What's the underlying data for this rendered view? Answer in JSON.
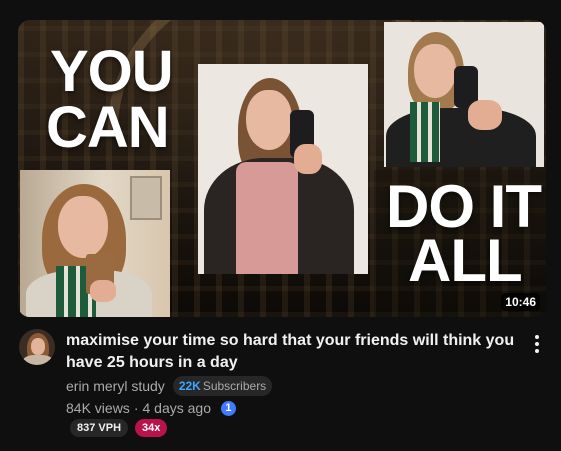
{
  "thumbnail": {
    "overlay_text_top": [
      "YOU",
      "CAN"
    ],
    "overlay_text_bottom": [
      "DO IT",
      "ALL"
    ],
    "duration": "10:46"
  },
  "video": {
    "title": "maximise your time so hard that your friends will think you have 25 hours in a day",
    "channel": "erin meryl study",
    "subscriber_count": "22K",
    "subscriber_label": "Subscribers",
    "views": "84K views",
    "separator": "·",
    "age": "4 days ago",
    "info_badge": "1"
  },
  "badges": {
    "vph": "837 VPH",
    "multiplier": "34x"
  },
  "colors": {
    "background": "#0f0f0f",
    "subscriber_count": "#3ea6ff",
    "info_badge": "#3e7bff",
    "multiplier_badge": "#b8134a"
  },
  "icons": {
    "menu": "more-vert-icon",
    "info": "info-count-icon"
  }
}
